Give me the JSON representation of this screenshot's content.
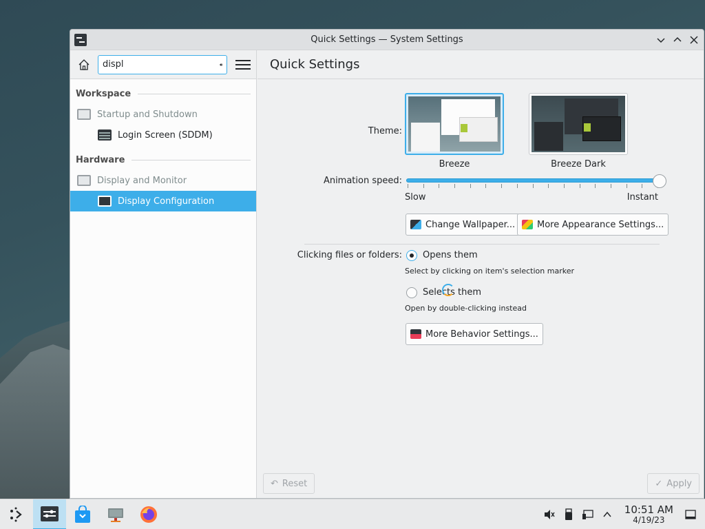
{
  "window": {
    "title": "Quick Settings — System Settings"
  },
  "sidebar": {
    "search_value": "displ",
    "groups": [
      {
        "label": "Workspace",
        "items": [
          {
            "label": "Startup and Shutdown",
            "child": false
          },
          {
            "label": "Login Screen (SDDM)",
            "child": true
          }
        ]
      },
      {
        "label": "Hardware",
        "items": [
          {
            "label": "Display and Monitor",
            "child": false
          },
          {
            "label": "Display Configuration",
            "child": true,
            "selected": true
          }
        ]
      }
    ]
  },
  "main": {
    "header": "Quick Settings",
    "theme_label": "Theme:",
    "themes": [
      {
        "name": "Breeze",
        "selected": true
      },
      {
        "name": "Breeze Dark",
        "selected": false
      }
    ],
    "animation_label": "Animation speed:",
    "animation_min": "Slow",
    "animation_max": "Instant",
    "animation_value": 1.0,
    "change_wallpaper": "Change Wallpaper...",
    "more_appearance": "More Appearance Settings...",
    "clicking_label": "Clicking files or folders:",
    "option_open": "Opens them",
    "option_open_hint": "Select by clicking on item's selection marker",
    "option_select": "Selects them",
    "option_select_hint": "Open by double-clicking instead",
    "more_behavior": "More Behavior Settings...",
    "reset": "Reset",
    "apply": "Apply"
  },
  "taskbar": {
    "time": "10:51 AM",
    "date": "4/19/23"
  },
  "colors": {
    "accent": "#3daee9"
  }
}
